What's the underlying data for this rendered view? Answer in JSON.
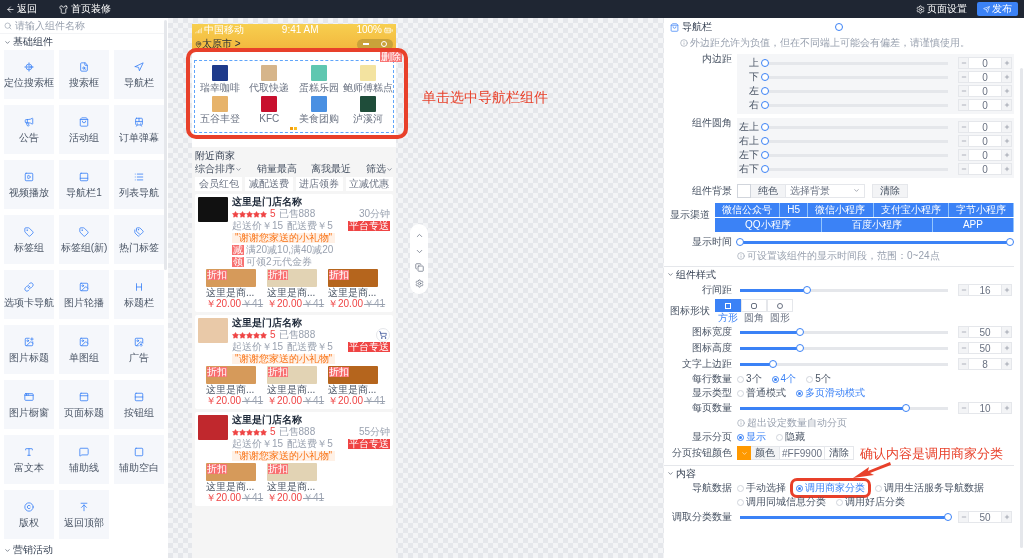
{
  "topbar": {
    "back": "返回",
    "title": "首页装修",
    "settings": "页面设置",
    "publish": "发布"
  },
  "library": {
    "search_placeholder": "请输入组件名称",
    "sections": [
      {
        "title": "基础组件",
        "items": [
          {
            "label": "定位搜索框"
          },
          {
            "label": "搜索框"
          },
          {
            "label": "导航栏"
          },
          {
            "label": "公告"
          },
          {
            "label": "活动组"
          },
          {
            "label": "订单弹幕"
          },
          {
            "label": "视频播放"
          },
          {
            "label": "导航栏1"
          },
          {
            "label": "列表导航"
          },
          {
            "label": "标签组"
          },
          {
            "label": "标签组(新)"
          },
          {
            "label": "热门标签"
          },
          {
            "label": "选项卡导航"
          },
          {
            "label": "图片轮播"
          },
          {
            "label": "标题栏"
          },
          {
            "label": "图片标题"
          },
          {
            "label": "单图组"
          },
          {
            "label": "广告"
          },
          {
            "label": "图片橱窗"
          },
          {
            "label": "页面标题"
          },
          {
            "label": "按钮组"
          },
          {
            "label": "富文本"
          },
          {
            "label": "辅助线"
          },
          {
            "label": "辅助空白"
          },
          {
            "label": "版权"
          },
          {
            "label": "返回顶部"
          }
        ]
      },
      {
        "title": "营销活动"
      }
    ]
  },
  "phone": {
    "status": {
      "carrier": "中国移动",
      "time": "9:41 AM",
      "battery": "100%"
    },
    "location": "太原市 >",
    "delete": "删除",
    "nav_items": [
      {
        "label": "瑞幸咖啡"
      },
      {
        "label": "代取快递"
      },
      {
        "label": "蛋糕乐园"
      },
      {
        "label": "鲍师傅糕点"
      },
      {
        "label": "五谷丰登"
      },
      {
        "label": "KFC"
      },
      {
        "label": "美食团购"
      },
      {
        "label": "泸溪河"
      }
    ],
    "nearby": {
      "title": "附近商家",
      "sorts": [
        {
          "label": "综合排序",
          "dropdown": true
        },
        {
          "label": "销量最高",
          "dropdown": false
        },
        {
          "label": "离我最近",
          "dropdown": false
        },
        {
          "label": "筛选",
          "dropdown": true
        }
      ],
      "chips": [
        "会员红包",
        "减配送费",
        "进店领券",
        "立减优惠"
      ],
      "stores": [
        {
          "name": "这里是门店名称",
          "stars": 5,
          "rating": "5",
          "sold": "已售888",
          "time": "30分钟",
          "min_order": "起送价￥15",
          "fee": "配送费￥5",
          "badge": "平台专送",
          "note": "\"谢谢您家送的小礼物\"",
          "promos": [
            {
              "tag": "减",
              "text": "满20减10,满40减20"
            },
            {
              "tag": "领",
              "text": "可领2元代金券"
            }
          ],
          "cart": false,
          "products": [
            {
              "tag": "折扣",
              "name": "这里是商...",
              "price": "￥20.00",
              "original": "￥41"
            },
            {
              "tag": "折扣",
              "name": "这里是商...",
              "price": "￥20.00",
              "original": "￥41"
            },
            {
              "tag": "折扣",
              "name": "这里是商...",
              "price": "￥20.00",
              "original": "￥41"
            }
          ]
        },
        {
          "name": "这里是门店名称",
          "stars": 5,
          "rating": "5",
          "sold": "已售888",
          "min_order": "起送价￥15",
          "fee": "配送费￥5",
          "badge": "平台专送",
          "note": "\"谢谢您家送的小礼物\"",
          "cart": true,
          "products": [
            {
              "tag": "折扣",
              "name": "这里是商...",
              "price": "￥20.00",
              "original": "￥41"
            },
            {
              "tag": "折扣",
              "name": "这里是商...",
              "price": "￥20.00",
              "original": "￥41"
            },
            {
              "tag": "折扣",
              "name": "这里是商...",
              "price": "￥20.00",
              "original": "￥41"
            }
          ]
        },
        {
          "name": "这里是门店名称",
          "stars": 5,
          "rating": "5",
          "sold": "已售888",
          "time": "55分钟",
          "min_order": "起送价￥15",
          "fee": "配送费￥5",
          "badge": "平台专送",
          "note": "\"谢谢您家送的小礼物\"",
          "cart": false,
          "products": [
            {
              "tag": "折扣",
              "name": "这里是商...",
              "price": "￥20.00",
              "original": "￥41"
            },
            {
              "tag": "折扣",
              "name": "这里是商...",
              "price": "￥20.00",
              "original": "￥41"
            }
          ]
        }
      ]
    }
  },
  "annotations": [
    {
      "text": "单击选中导航栏组件"
    },
    {
      "text": "确认内容是调用商家分类"
    }
  ],
  "panel": {
    "title": "导航栏",
    "blocks": [
      {
        "kind": "note",
        "text": "外边距允许为负值，但在不同端上可能会有偏差，请谨慎使用。"
      },
      {
        "kind": "group",
        "label": "内边距",
        "rows": [
          {
            "label": "上",
            "level": 0,
            "value": "0"
          },
          {
            "label": "下",
            "level": 0,
            "value": "0"
          },
          {
            "label": "左",
            "level": 0,
            "value": "0"
          },
          {
            "label": "右",
            "level": 0,
            "value": "0"
          }
        ]
      },
      {
        "kind": "group",
        "label": "组件圆角",
        "rows": [
          {
            "label": "左上",
            "level": 0,
            "value": "0"
          },
          {
            "label": "右上",
            "level": 0,
            "value": "0"
          },
          {
            "label": "左下",
            "level": 0,
            "value": "0"
          },
          {
            "label": "右下",
            "level": 0,
            "value": "0"
          }
        ]
      },
      {
        "kind": "background",
        "label": "组件背景",
        "mode": "纯色",
        "placeholder": "选择背景",
        "clear": "清除"
      },
      {
        "kind": "segments",
        "label": "显示渠道",
        "options": [
          {
            "label": "微信公众号",
            "selected": true
          },
          {
            "label": "H5",
            "selected": true
          },
          {
            "label": "微信小程序",
            "selected": true
          },
          {
            "label": "支付宝小程序",
            "selected": true
          },
          {
            "label": "字节小程序",
            "selected": true
          },
          {
            "label": "QQ小程序",
            "selected": true
          },
          {
            "label": "百度小程序",
            "selected": true
          },
          {
            "label": "APP",
            "selected": true
          }
        ]
      },
      {
        "kind": "range",
        "label": "显示时间",
        "level": 1
      },
      {
        "kind": "note",
        "text": "可设置该组件的显示时间段，范围：0~24点"
      },
      {
        "kind": "section",
        "title": "组件样式"
      },
      {
        "kind": "slider",
        "label": "行间距",
        "level": 0.32,
        "value": "16"
      },
      {
        "kind": "shape",
        "label": "图标形状",
        "options": [
          {
            "label": "方形",
            "selected": true
          },
          {
            "label": "圆角",
            "selected": false
          },
          {
            "label": "圆形",
            "selected": false
          }
        ]
      },
      {
        "kind": "slider",
        "label": "图标宽度",
        "level": 0.29,
        "value": "50"
      },
      {
        "kind": "slider",
        "label": "图标高度",
        "level": 0.29,
        "value": "50"
      },
      {
        "kind": "slider",
        "label": "文字上边距",
        "level": 0.16,
        "value": "8"
      },
      {
        "kind": "radio",
        "label": "每行数量",
        "options": [
          {
            "label": "3个",
            "selected": false
          },
          {
            "label": "4个",
            "selected": true
          },
          {
            "label": "5个",
            "selected": false
          }
        ]
      },
      {
        "kind": "radio",
        "label": "显示类型",
        "options": [
          {
            "label": "普通模式",
            "selected": false
          },
          {
            "label": "多页滑动模式",
            "selected": true
          }
        ]
      },
      {
        "kind": "slider",
        "label": "每页数量",
        "level": 0.8,
        "value": "10"
      },
      {
        "kind": "note",
        "text": "超出设定数量自动分页"
      },
      {
        "kind": "radio",
        "label": "显示分页",
        "options": [
          {
            "label": "显示",
            "selected": true
          },
          {
            "label": "隐藏",
            "selected": false
          }
        ]
      },
      {
        "kind": "color",
        "label": "分页按钮颜色",
        "color": "#ff9900",
        "mode": "颜色",
        "value": "#FF9900",
        "clear": "清除"
      },
      {
        "kind": "section",
        "title": "内容"
      },
      {
        "kind": "radio",
        "label": "导航数据",
        "highlight": true,
        "options": [
          {
            "label": "手动选择",
            "selected": false
          },
          {
            "label": "调用商家分类",
            "selected": true
          },
          {
            "label": "调用生活服务导航数据",
            "selected": false
          },
          {
            "label": "调用同城信息分类",
            "selected": false
          },
          {
            "label": "调用好店分类",
            "selected": false
          }
        ]
      },
      {
        "kind": "slider",
        "label": "调取分类数量",
        "level": 1,
        "value": "50"
      }
    ]
  }
}
